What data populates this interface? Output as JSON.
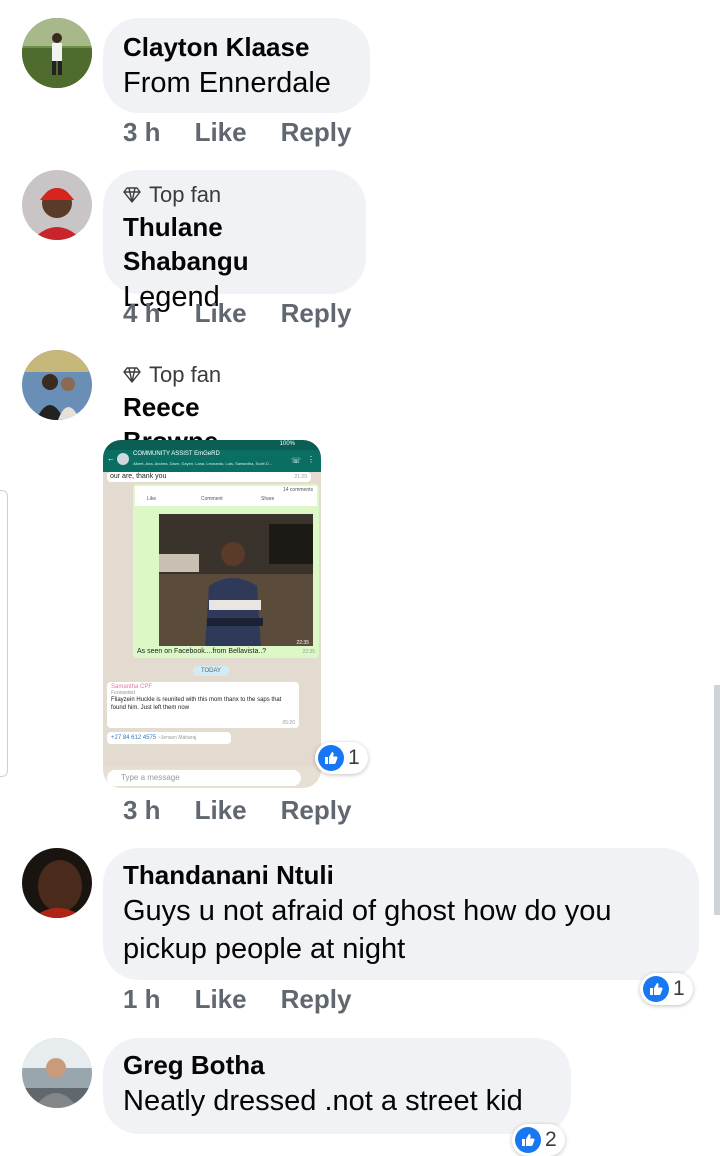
{
  "comments": [
    {
      "name": "Clayton Klaase",
      "text": "From  Ennerdale",
      "time": "3 h",
      "like": "Like",
      "reply": "Reply"
    },
    {
      "badge": "Top fan",
      "name": "Thulane Shabangu",
      "text": "Legend",
      "time": "4 h",
      "like": "Like",
      "reply": "Reply"
    },
    {
      "badge": "Top fan",
      "name": "Reece Browne",
      "time": "3 h",
      "like": "Like",
      "reply": "Reply",
      "reaction_count": "1",
      "attachment": {
        "group_title": "COMMUNITY ASSIST EmGeRD",
        "members": "Albert, Ana, Andrea, Dave, Gayen, Lana, Leonardo, Luis, Samantha, Scott D...",
        "status": "100%",
        "top_text": "our are, thank you",
        "top_time": "21:29",
        "fb_comments": "14 comments",
        "fb_like": "Like",
        "fb_comment": "Comment",
        "fb_share": "Share",
        "photo_time": "22:35",
        "caption": "As seen on Facebook....from Bellavista..?",
        "caption_time": "22:35",
        "day": "TODAY",
        "sender": "Samantha CPF",
        "forwarded": "Forwarded",
        "fwd_text": "Fliayzein  Huckle is reunited with this mom thanx to the saps that found him. Just left them now",
        "fwd_time": "05:20",
        "phone": "+27 84 612 4575",
        "phone_name": "~Jensen Maharaj",
        "input_placeholder": "Type a message"
      }
    },
    {
      "name": "Thandanani Ntuli",
      "text_line1": "Guys u not afraid of ghost how do you",
      "text_line2": "pickup people at night",
      "time": "1 h",
      "like": "Like",
      "reply": "Reply",
      "reaction_count": "1"
    },
    {
      "name": "Greg Botha",
      "text": "Neatly dressed .not a street kid",
      "reaction_count": "2"
    }
  ],
  "colors": {
    "like_blue": "#1877f2",
    "bubble": "#f0f2f5",
    "meta": "#606770"
  }
}
